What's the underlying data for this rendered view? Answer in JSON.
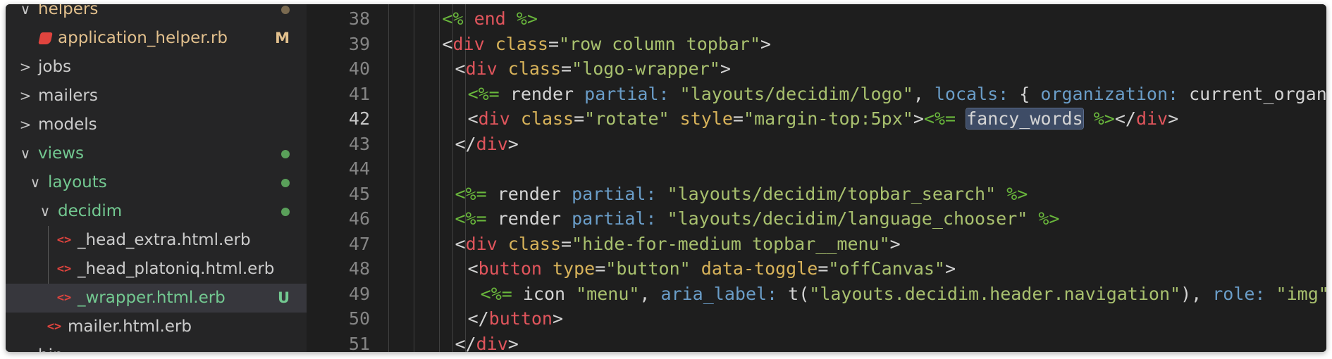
{
  "colors": {
    "modified": "#e2c08d",
    "untracked": "#73c991",
    "dot": "#5aa05a",
    "folder_text": "#cccccc"
  },
  "explorer": {
    "items": [
      {
        "kind": "folder",
        "label": "helpers",
        "expanded": true,
        "depth": 0,
        "color": "#e2c08d",
        "dot": true,
        "dot_color": "#7a6a50"
      },
      {
        "kind": "file",
        "icon": "ruby-icon",
        "label": "application_helper.rb",
        "depth": 1,
        "status": "M",
        "color": "#e2c08d"
      },
      {
        "kind": "folder",
        "label": "jobs",
        "expanded": false,
        "depth": 0,
        "color": "#cccccc"
      },
      {
        "kind": "folder",
        "label": "mailers",
        "expanded": false,
        "depth": 0,
        "color": "#cccccc"
      },
      {
        "kind": "folder",
        "label": "models",
        "expanded": false,
        "depth": 0,
        "color": "#cccccc"
      },
      {
        "kind": "folder",
        "label": "views",
        "expanded": true,
        "depth": 0,
        "color": "#73c991",
        "dot": true,
        "dot_color": "#5aa05a"
      },
      {
        "kind": "folder",
        "label": "layouts",
        "expanded": true,
        "depth": 1,
        "color": "#73c991",
        "dot": true,
        "dot_color": "#5aa05a"
      },
      {
        "kind": "folder",
        "label": "decidim",
        "expanded": true,
        "depth": 2,
        "color": "#73c991",
        "dot": true,
        "dot_color": "#5aa05a"
      },
      {
        "kind": "file",
        "icon": "code-icon",
        "label": "_head_extra.html.erb",
        "depth": 3,
        "color": "#cccccc"
      },
      {
        "kind": "file",
        "icon": "code-icon",
        "label": "_head_platoniq.html.erb",
        "depth": 3,
        "color": "#cccccc"
      },
      {
        "kind": "file",
        "icon": "code-icon",
        "label": "_wrapper.html.erb",
        "depth": 3,
        "status": "U",
        "color": "#73c991",
        "selected": true
      },
      {
        "kind": "file",
        "icon": "code-icon",
        "label": "mailer.html.erb",
        "depth": 2,
        "color": "#cccccc"
      },
      {
        "kind": "folder",
        "label": "bin",
        "expanded": false,
        "depth": 0,
        "color": "#cccccc"
      }
    ],
    "icon_glyph": "<>",
    "chevron_open": "∨",
    "chevron_closed": ">"
  },
  "editor": {
    "active_line": 42,
    "lines": [
      {
        "n": 38,
        "indent": 6,
        "tokens": [
          [
            "erb",
            "<% "
          ],
          [
            "tag",
            "end"
          ],
          [
            "erb",
            " %>"
          ]
        ]
      },
      {
        "n": 39,
        "indent": 6,
        "tokens": [
          [
            "plain",
            "<"
          ],
          [
            "tag",
            "div"
          ],
          [
            "plain",
            " "
          ],
          [
            "attr",
            "class"
          ],
          [
            "plain",
            "="
          ],
          [
            "str",
            "\"row column topbar\""
          ],
          [
            "plain",
            ">"
          ]
        ]
      },
      {
        "n": 40,
        "indent": 7,
        "tokens": [
          [
            "plain",
            "<"
          ],
          [
            "tag",
            "div"
          ],
          [
            "plain",
            " "
          ],
          [
            "attr",
            "class"
          ],
          [
            "plain",
            "="
          ],
          [
            "str",
            "\"logo-wrapper\""
          ],
          [
            "plain",
            ">"
          ]
        ]
      },
      {
        "n": 41,
        "indent": 8,
        "tokens": [
          [
            "erb",
            "<%="
          ],
          [
            "plain",
            " render "
          ],
          [
            "sym",
            "partial:"
          ],
          [
            "plain",
            " "
          ],
          [
            "str",
            "\"layouts/decidim/logo\""
          ],
          [
            "plain",
            ", "
          ],
          [
            "sym",
            "locals:"
          ],
          [
            "plain",
            " { "
          ],
          [
            "sym",
            "organization:"
          ],
          [
            "plain",
            " current_organization } %>"
          ]
        ]
      },
      {
        "n": 42,
        "indent": 8,
        "tokens": [
          [
            "plain",
            "<"
          ],
          [
            "tag",
            "div"
          ],
          [
            "plain",
            " "
          ],
          [
            "attr",
            "class"
          ],
          [
            "plain",
            "="
          ],
          [
            "str",
            "\"rotate\""
          ],
          [
            "plain",
            " "
          ],
          [
            "attr",
            "style"
          ],
          [
            "plain",
            "="
          ],
          [
            "str",
            "\"margin-top:5px\""
          ],
          [
            "plain",
            ">"
          ],
          [
            "erb",
            "<%="
          ],
          [
            "plain",
            " "
          ],
          [
            "hl",
            "fancy_words"
          ],
          [
            "plain",
            " "
          ],
          [
            "erb",
            "%>"
          ],
          [
            "plain",
            "</"
          ],
          [
            "tag",
            "div"
          ],
          [
            "plain",
            ">"
          ]
        ]
      },
      {
        "n": 43,
        "indent": 7,
        "tokens": [
          [
            "plain",
            "</"
          ],
          [
            "tag",
            "div"
          ],
          [
            "plain",
            ">"
          ]
        ]
      },
      {
        "n": 44,
        "indent": 0,
        "tokens": []
      },
      {
        "n": 45,
        "indent": 7,
        "tokens": [
          [
            "erb",
            "<%="
          ],
          [
            "plain",
            " render "
          ],
          [
            "sym",
            "partial:"
          ],
          [
            "plain",
            " "
          ],
          [
            "str",
            "\"layouts/decidim/topbar_search\""
          ],
          [
            "plain",
            " "
          ],
          [
            "erb",
            "%>"
          ]
        ]
      },
      {
        "n": 46,
        "indent": 7,
        "tokens": [
          [
            "erb",
            "<%="
          ],
          [
            "plain",
            " render "
          ],
          [
            "sym",
            "partial:"
          ],
          [
            "plain",
            " "
          ],
          [
            "str",
            "\"layouts/decidim/language_chooser\""
          ],
          [
            "plain",
            " "
          ],
          [
            "erb",
            "%>"
          ]
        ]
      },
      {
        "n": 47,
        "indent": 7,
        "tokens": [
          [
            "plain",
            "<"
          ],
          [
            "tag",
            "div"
          ],
          [
            "plain",
            " "
          ],
          [
            "attr",
            "class"
          ],
          [
            "plain",
            "="
          ],
          [
            "str",
            "\"hide-for-medium topbar__menu\""
          ],
          [
            "plain",
            ">"
          ]
        ]
      },
      {
        "n": 48,
        "indent": 8,
        "tokens": [
          [
            "plain",
            "<"
          ],
          [
            "tag",
            "button"
          ],
          [
            "plain",
            " "
          ],
          [
            "attr",
            "type"
          ],
          [
            "plain",
            "="
          ],
          [
            "str",
            "\"button\""
          ],
          [
            "plain",
            " "
          ],
          [
            "attr",
            "data-toggle"
          ],
          [
            "plain",
            "="
          ],
          [
            "str",
            "\"offCanvas\""
          ],
          [
            "plain",
            ">"
          ]
        ]
      },
      {
        "n": 49,
        "indent": 9,
        "tokens": [
          [
            "erb",
            "<%="
          ],
          [
            "plain",
            " icon "
          ],
          [
            "str",
            "\"menu\""
          ],
          [
            "plain",
            ", "
          ],
          [
            "sym",
            "aria_label:"
          ],
          [
            "plain",
            " t("
          ],
          [
            "str",
            "\"layouts.decidim.header.navigation\""
          ],
          [
            "plain",
            "), "
          ],
          [
            "sym",
            "role:"
          ],
          [
            "plain",
            " "
          ],
          [
            "str",
            "\"img\""
          ],
          [
            "plain",
            " %>"
          ]
        ]
      },
      {
        "n": 50,
        "indent": 8,
        "tokens": [
          [
            "plain",
            "</"
          ],
          [
            "tag",
            "button"
          ],
          [
            "plain",
            ">"
          ]
        ]
      },
      {
        "n": 51,
        "indent": 7,
        "tokens": [
          [
            "plain",
            "</"
          ],
          [
            "tag",
            "div"
          ],
          [
            "plain",
            ">"
          ]
        ]
      }
    ]
  }
}
